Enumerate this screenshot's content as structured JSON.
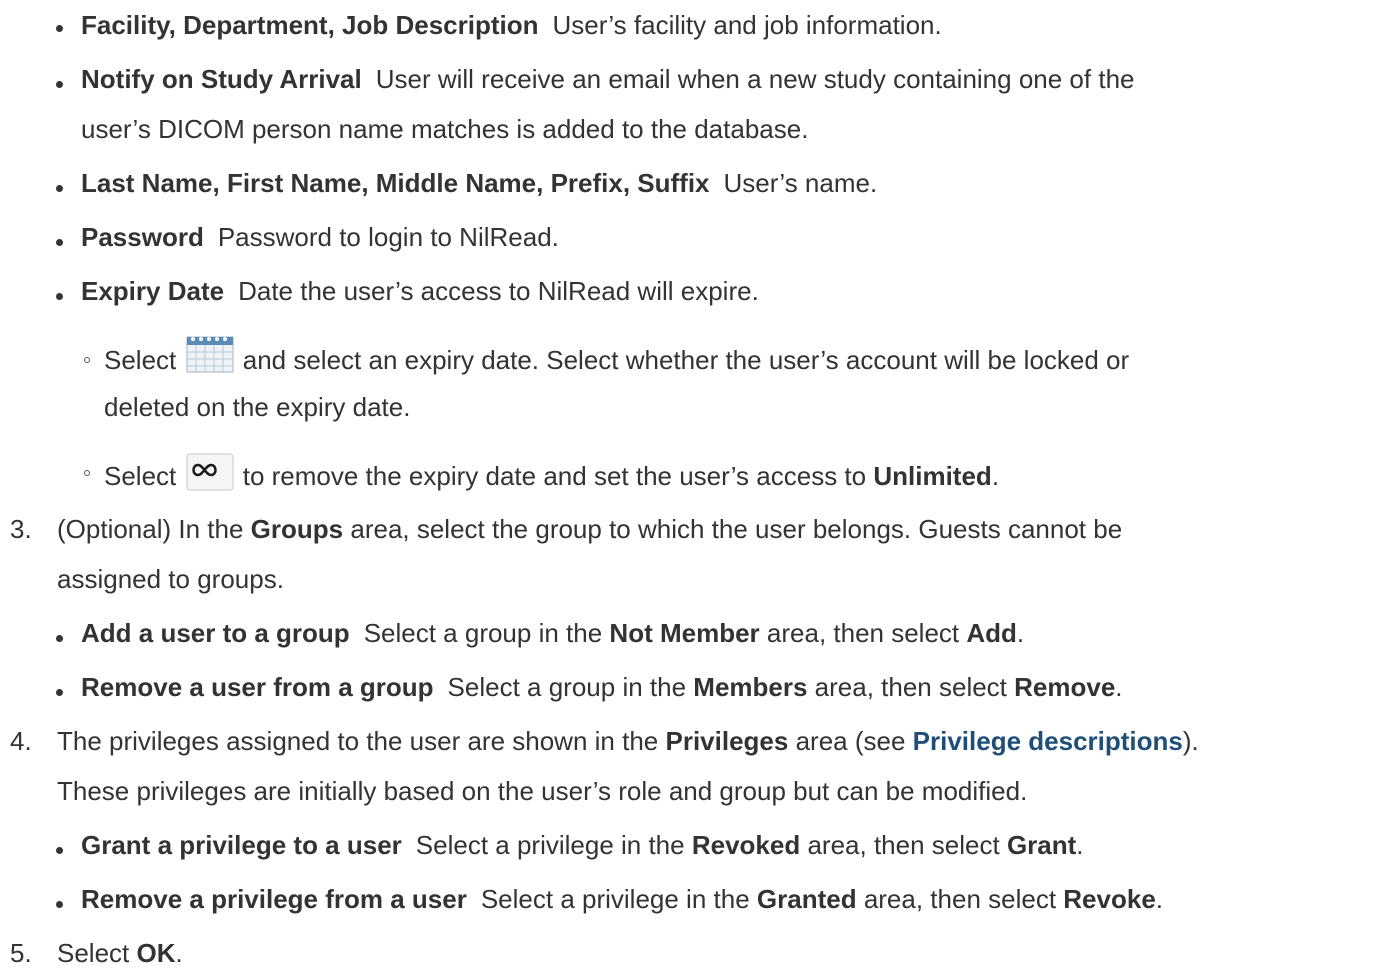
{
  "items": {
    "facility": {
      "term": "Facility, Department, Job Description",
      "desc": "User’s facility and job information."
    },
    "notify": {
      "term": "Notify on Study Arrival",
      "desc1": "User will receive an email when a new study containing one of the",
      "desc2": "user’s DICOM person name matches is added to the database."
    },
    "name": {
      "term": "Last Name, First Name, Middle Name, Prefix, Suffix",
      "desc": "User’s name."
    },
    "password": {
      "term": "Password",
      "desc": "Password to login to NilRead."
    },
    "expiry": {
      "term": "Expiry Date",
      "desc": "Date the user’s access to NilRead will expire."
    },
    "expiry_sub1": {
      "pre": "Select",
      "post": "and select an expiry date. Select whether the user’s account will be locked or",
      "line2": "deleted on the expiry date.",
      "icon": "calendar-icon"
    },
    "expiry_sub2": {
      "pre": "Select",
      "post": "to remove the expiry date and set the user’s access to",
      "bold": "Unlimited",
      "end": ".",
      "icon": "infinity-icon"
    }
  },
  "step3": {
    "num": "3.",
    "a": "(Optional) In the",
    "b": "Groups",
    "c": "area, select the group to which the user belongs. Guests cannot be",
    "line2": "assigned to groups.",
    "add": {
      "term": "Add a user to a group",
      "a": "Select a group in the",
      "b": "Not Member",
      "c": "area, then select",
      "d": "Add",
      "e": "."
    },
    "remove": {
      "term": "Remove a user from a group",
      "a": "Select a group in the",
      "b": "Members",
      "c": "area, then select",
      "d": "Remove",
      "e": "."
    }
  },
  "step4": {
    "num": "4.",
    "a": "The privileges assigned to the user are shown in the",
    "b": "Privileges",
    "c": "area (see",
    "link": "Privilege descriptions",
    "d": ").",
    "line2": "These privileges are initially based on the user’s role and group but can be modified.",
    "grant": {
      "term": "Grant a privilege to a user",
      "a": "Select a privilege in the",
      "b": "Revoked",
      "c": "area, then select",
      "d": "Grant",
      "e": "."
    },
    "revoke": {
      "term": "Remove a privilege from a user",
      "a": "Select a privilege in the",
      "b": "Granted",
      "c": "area, then select",
      "d": "Revoke",
      "e": "."
    }
  },
  "step5": {
    "num": "5.",
    "a": "Select",
    "b": "OK",
    "c": "."
  },
  "colors": {
    "text": "#333333",
    "link": "#1f4e79"
  }
}
